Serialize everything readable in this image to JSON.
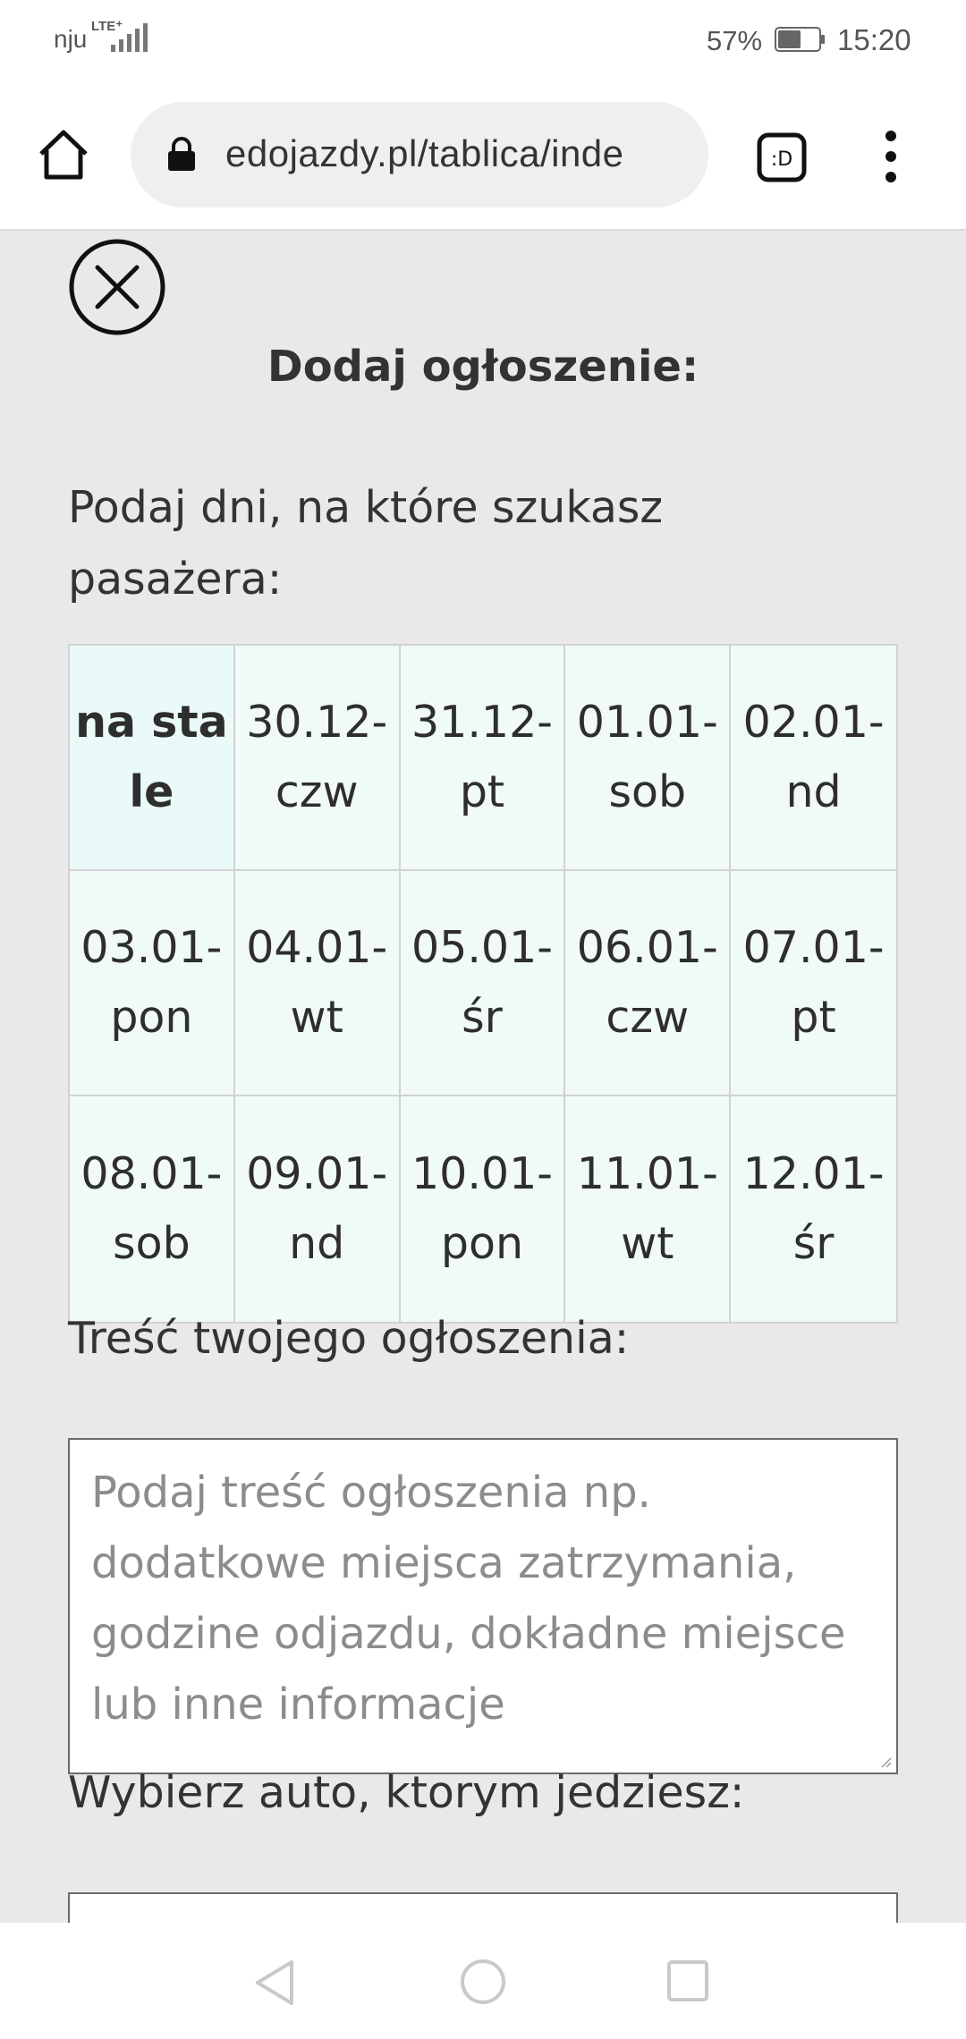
{
  "status_bar": {
    "carrier": "nju",
    "network": "LTE⁺",
    "battery_percent": "57%",
    "battery_level": 0.57,
    "time": "15:20"
  },
  "browser": {
    "url": "edojazdy.pl/tablica/inde",
    "tabs_label": ":D",
    "icons": [
      "home-icon",
      "lock-icon",
      "tab-switcher-icon",
      "more-vert-icon"
    ]
  },
  "modal": {
    "title": "Dodaj ogłoszenie:",
    "days_label": "Podaj dni, na które szukasz pasażera:",
    "days": [
      {
        "label": "na stale",
        "bold": true
      },
      {
        "label": "30.12-czw"
      },
      {
        "label": "31.12-pt"
      },
      {
        "label": "01.01-sob"
      },
      {
        "label": "02.01-nd"
      },
      {
        "label": "03.01-pon"
      },
      {
        "label": "04.01-wt"
      },
      {
        "label": "05.01-śr"
      },
      {
        "label": "06.01-czw"
      },
      {
        "label": "07.01-pt"
      },
      {
        "label": "08.01-sob"
      },
      {
        "label": "09.01-nd"
      },
      {
        "label": "10.01-pon"
      },
      {
        "label": "11.01-wt"
      },
      {
        "label": "12.01-śr"
      }
    ],
    "content_label": "Treść twojego ogłoszenia:",
    "content_placeholder": "Podaj treść ogłoszenia np. dodatkowe miejsca zatrzymania, godzine odjazdu, dokładne miejsce lub inne informacje",
    "car_label": "Wybierz auto, ktorym jedziesz:"
  },
  "colors": {
    "page_bg": "#e9e9e9",
    "cell_bg": "#f0faf6",
    "cell_border": "#d2d2d2",
    "text": "#333333"
  }
}
